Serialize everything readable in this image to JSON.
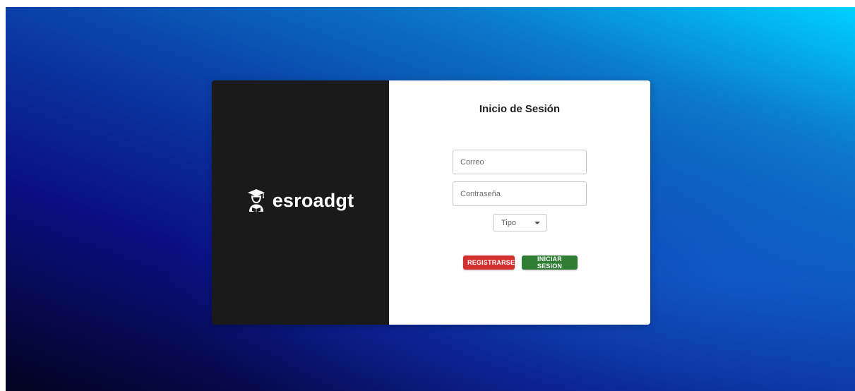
{
  "brand": {
    "name": "esroadgt",
    "icon": "graduate-student-icon"
  },
  "login": {
    "title": "Inicio de Sesión",
    "email_placeholder": "Correo",
    "password_placeholder": "Contraseña",
    "type_select_label": "Tipo",
    "register_label": "REGISTRARSE",
    "login_label": "INICIAR SESION"
  },
  "colors": {
    "register_button": "#d32f2f",
    "login_button": "#2e7d32",
    "brand_panel": "#1a1a1a"
  }
}
